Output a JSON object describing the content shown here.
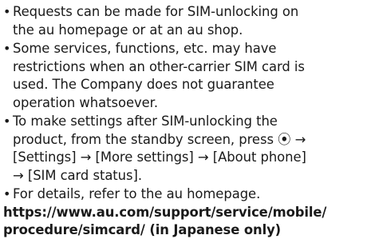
{
  "notes": [
    {
      "bullet": "•",
      "lines": [
        "Requests can be made for SIM-unlocking on",
        "the au homepage or at an au shop."
      ]
    },
    {
      "bullet": "•",
      "lines": [
        "Some services, functions, etc. may have",
        "restrictions when an other-carrier SIM card is",
        "used. The Company does not guarantee",
        "operation whatsoever."
      ]
    },
    {
      "bullet": "•",
      "lines": [
        "To make settings after SIM-unlocking the",
        "product, from the standby screen, press ⦿ →",
        "[Settings] → [More settings] → [About phone]",
        "→ [SIM card status]."
      ]
    },
    {
      "bullet": "•",
      "lines": [
        "For details, refer to the au homepage."
      ]
    }
  ],
  "url": {
    "lines": [
      "https://www.au.com/support/service/mobile/",
      "procedure/simcard/ (in Japanese only)"
    ]
  }
}
